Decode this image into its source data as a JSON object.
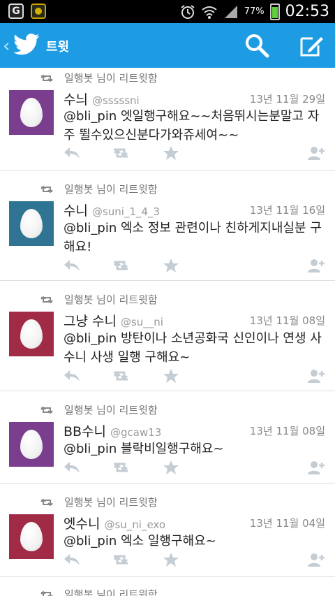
{
  "status_bar": {
    "battery": "77%",
    "time": "02:53"
  },
  "header": {
    "title": "트윗"
  },
  "tweets": [
    {
      "retweet_text": "일행봇 님이 리트윗함",
      "name": "수늬",
      "handle": "@sssssni",
      "date": "13년 11월 29일",
      "text": "@bli_pin 엣일행구해요~~처음뛰시는분말고  자주 뛸수있으신분다가와쥬세여~~",
      "avatar_color": "#7b3d8e"
    },
    {
      "retweet_text": "일행봇 님이 리트윗함",
      "name": "수니",
      "handle": "@suni_1_4_3",
      "date": "13년 11월 16일",
      "text": "@bli_pin 엑소 정보 관련이나 친하게지내실분 구해요!",
      "avatar_color": "#2f7492"
    },
    {
      "retweet_text": "일행봇 님이 리트윗함",
      "name": "그냥 수니",
      "handle": "@su__ni",
      "date": "13년 11월 08일",
      "text": "@bli_pin 방탄이나 소년공화국 신인이나 연생 사수니 사생 일행 구해요~",
      "avatar_color": "#a12a46"
    },
    {
      "retweet_text": "일행봇 님이 리트윗함",
      "name": "BB수니",
      "handle": "@gcaw13",
      "date": "13년 11월 08일",
      "text": "@bli_pin 블락비일행구해요~",
      "avatar_color": "#7b3d8e"
    },
    {
      "retweet_text": "일행봇 님이 리트윗함",
      "name": "엣수니",
      "handle": "@su_ni_exo",
      "date": "13년 11월 04일",
      "text": "@bli_pin 엑소 일행구해요~",
      "avatar_color": "#a12a46"
    },
    {
      "retweet_text": "일행봇 님이 리트윗함"
    }
  ]
}
